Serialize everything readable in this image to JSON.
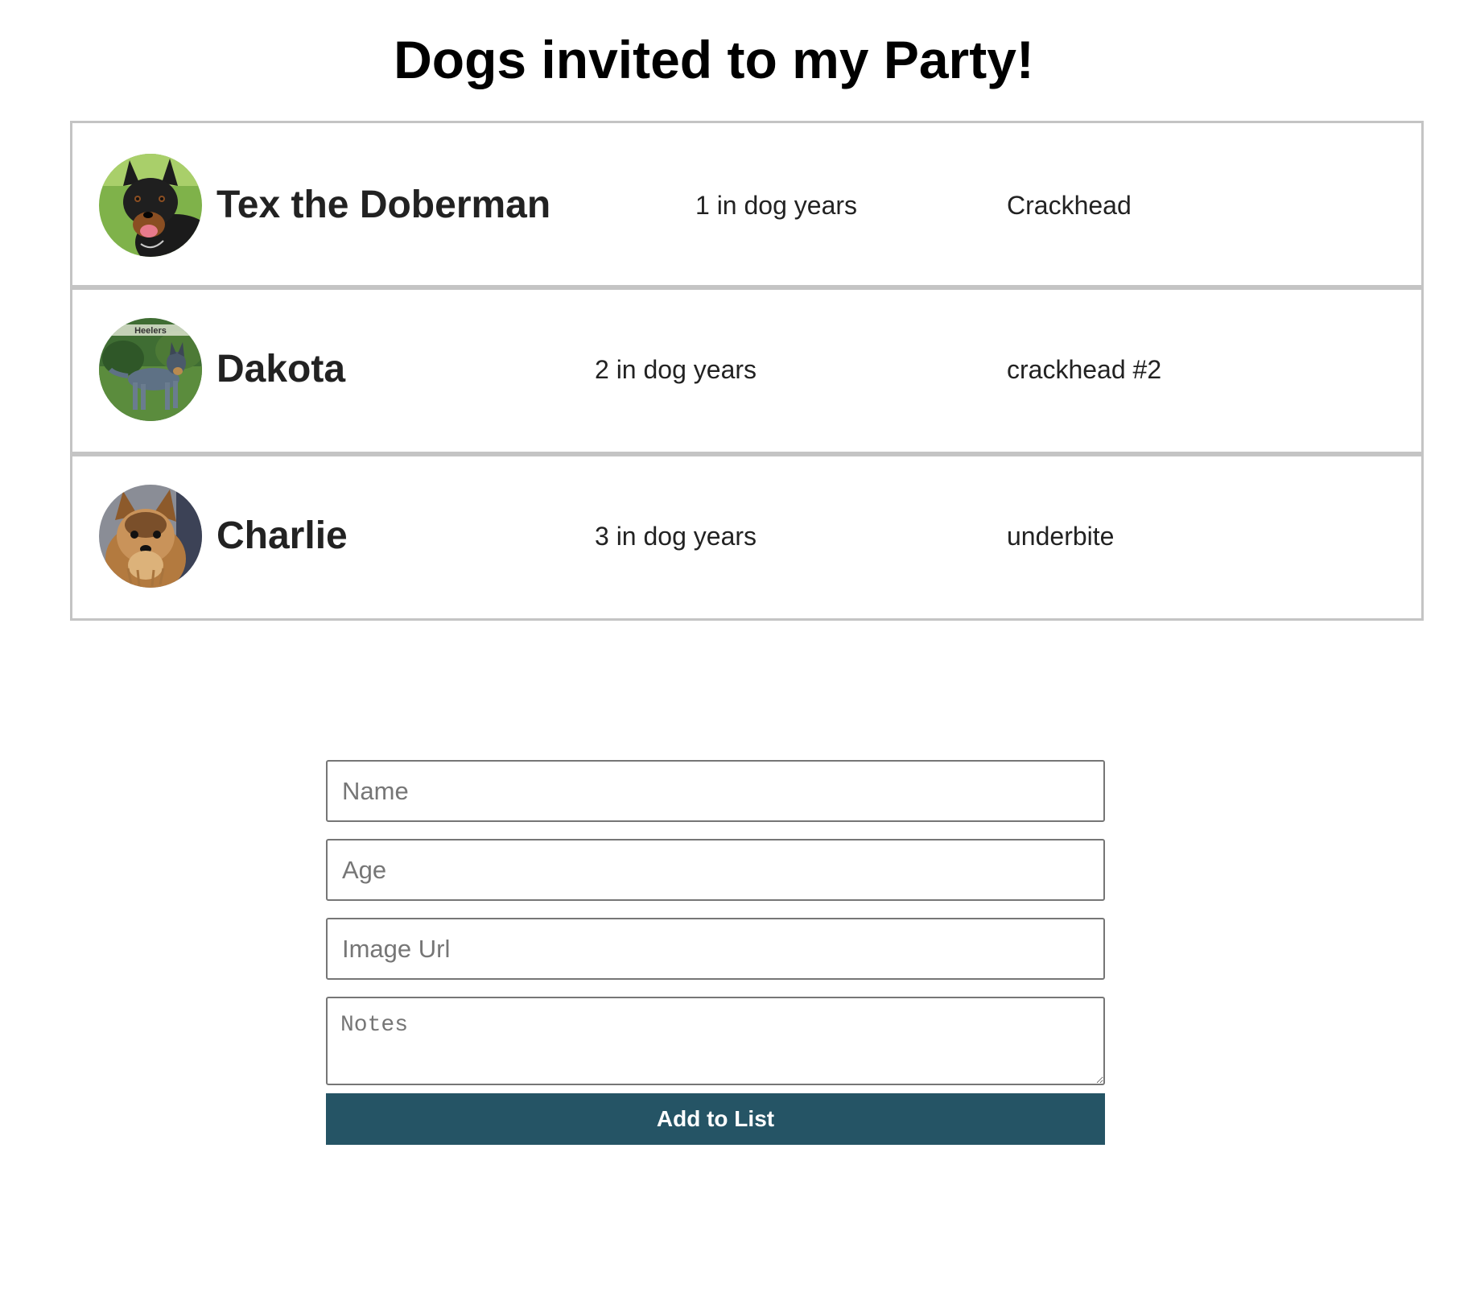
{
  "page": {
    "title": "Dogs invited to my Party!"
  },
  "dogs": [
    {
      "name": "Tex the Doberman",
      "age": "1 in dog years",
      "note": "Crackhead",
      "photo": "doberman-photo"
    },
    {
      "name": "Dakota",
      "age": "2 in dog years",
      "note": "crackhead #2",
      "photo": "heeler-photo",
      "photo_caption": "Heelers"
    },
    {
      "name": "Charlie",
      "age": "3 in dog years",
      "note": "underbite",
      "photo": "yorkie-photo"
    }
  ],
  "form": {
    "name_placeholder": "Name",
    "age_placeholder": "Age",
    "image_url_placeholder": "Image Url",
    "notes_placeholder": "Notes",
    "submit_label": "Add to List"
  },
  "colors": {
    "button_background": "#255465",
    "row_border": "#c4c4c4",
    "input_border": "#767676"
  }
}
